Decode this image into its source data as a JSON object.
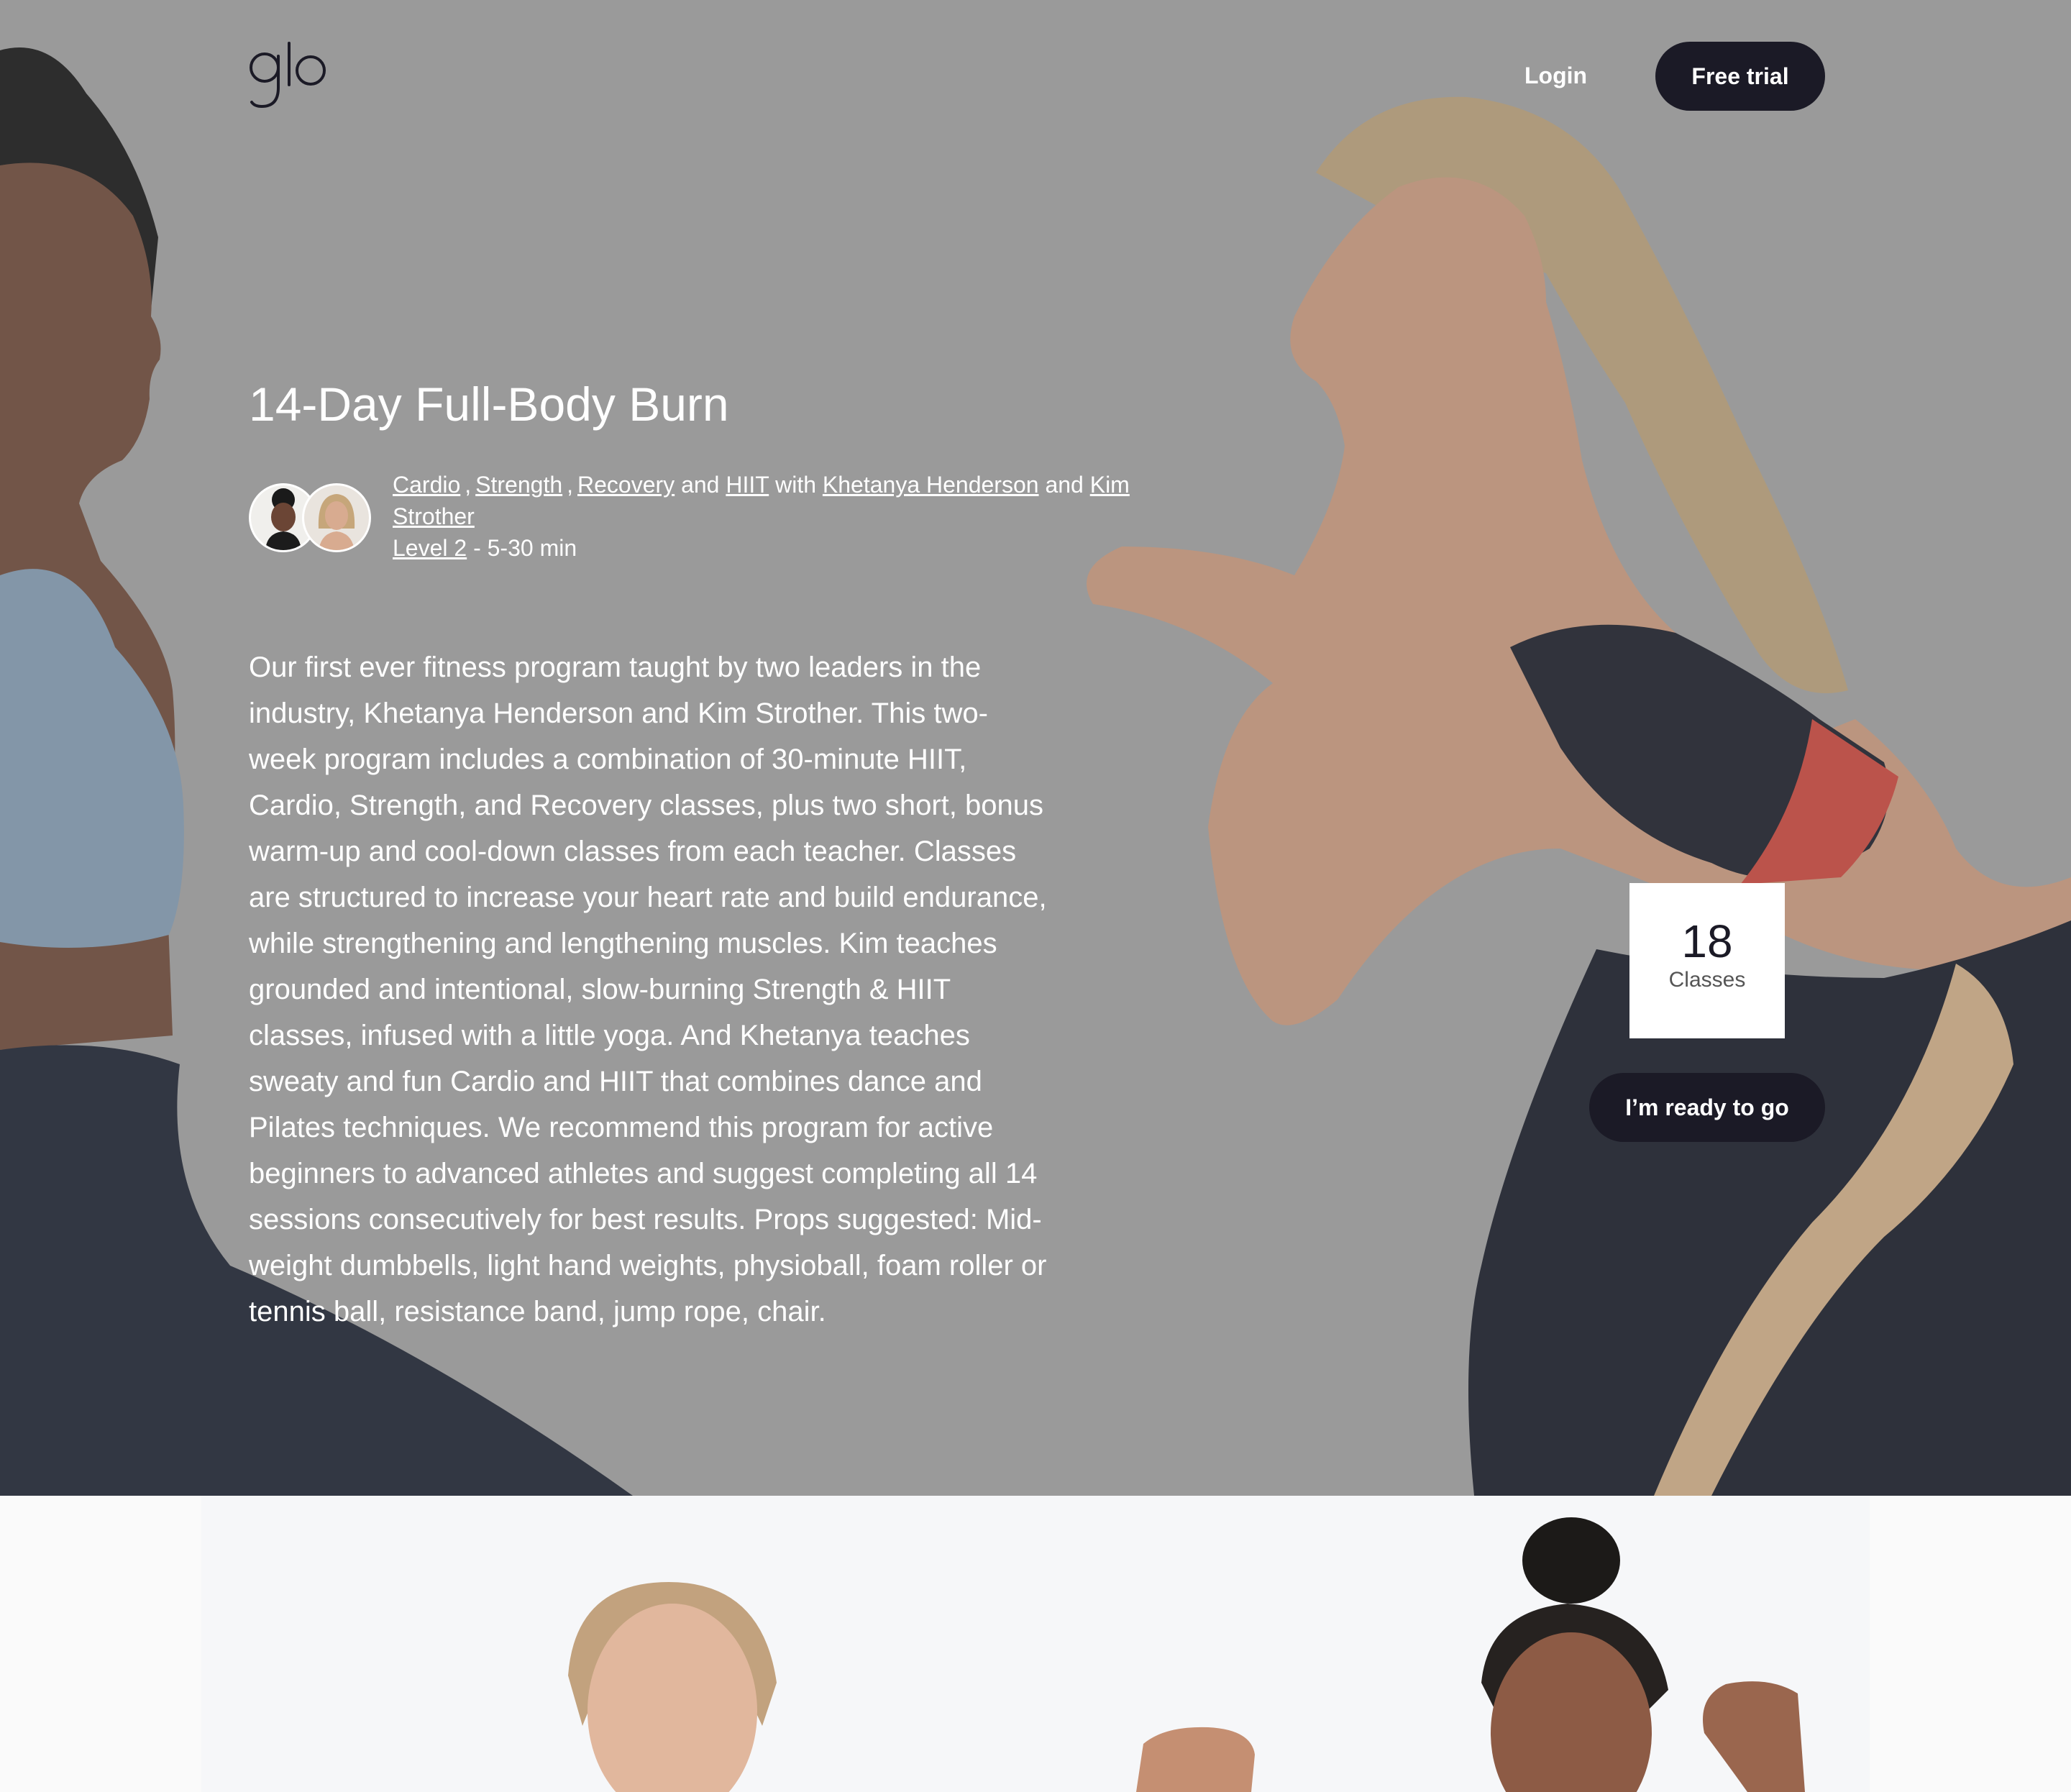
{
  "header": {
    "logo_text": "glo",
    "login_label": "Login",
    "trial_label": "Free trial"
  },
  "program": {
    "title": "14-Day Full-Body Burn",
    "categories": [
      "Cardio",
      "Strength",
      "Recovery",
      "HIIT"
    ],
    "connector_and": "and",
    "connector_with": "with",
    "teachers": [
      "Khetanya Henderson",
      "Kim Strother"
    ],
    "level_label": "Level 2",
    "duration": "- 5-30 min",
    "description": "Our first ever fitness program taught by two leaders in the industry, Khetanya Henderson and Kim Strother. This two-week program includes a combination of 30-minute HIIT, Cardio, Strength, and Recovery classes, plus two short, bonus warm-up and cool-down classes from each teacher. Classes are structured to increase your heart rate and build endurance, while strengthening and lengthening muscles. Kim teaches grounded and intentional, slow-burning Strength & HIIT classes, infused with a little yoga. And Khetanya teaches sweaty and fun Cardio and HIIT that combines dance and Pilates techniques. We recommend this program for active beginners to advanced athletes and suggest completing all 14 sessions consecutively for best results. Props suggested: Mid-weight dumbbells, light hand weights, physioball, foam roller or tennis ball, resistance band, jump rope, chair."
  },
  "classes_card": {
    "count": "18",
    "label": "Classes"
  },
  "cta": {
    "ready_label": "I’m ready to go"
  },
  "colors": {
    "hero_bg": "#9a9a9a",
    "dark_button": "#1b1a26",
    "white": "#ffffff",
    "lower_bg": "#fafafa"
  }
}
